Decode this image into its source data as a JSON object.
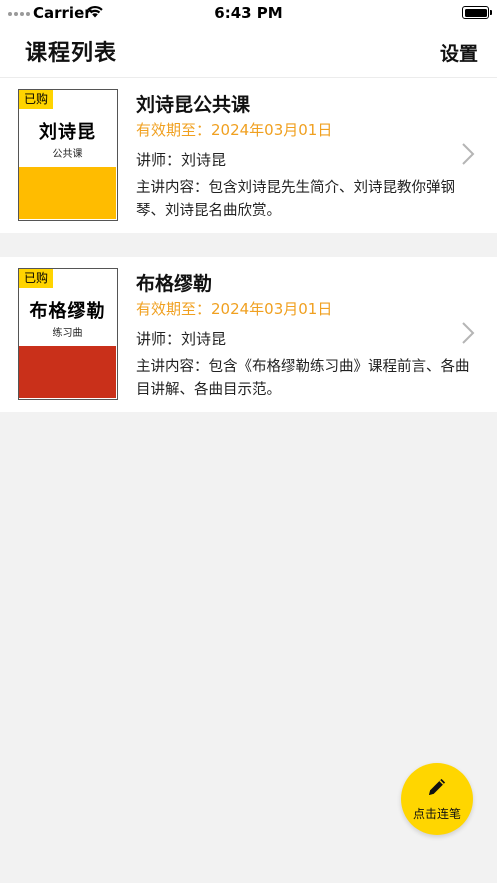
{
  "status_bar": {
    "carrier": "Carrier",
    "time": "6:43 PM",
    "icons": [
      "signal-dots-icon",
      "wifi-icon",
      "battery-icon"
    ]
  },
  "nav": {
    "title": "课程列表",
    "settings_label": "设置"
  },
  "courses": [
    {
      "cover_badge": "已购",
      "cover_name": "刘诗昆",
      "cover_sub": "公共课",
      "cover_band_color": "#ffbc00",
      "title": "刘诗昆公共课",
      "expiry": "有效期至：2024年03月01日",
      "teacher": "讲师：刘诗昆",
      "description": "主讲内容：包含刘诗昆先生简介、刘诗昆教你弹钢琴、刘诗昆名曲欣赏。"
    },
    {
      "cover_badge": "已购",
      "cover_name": "布格缪勒",
      "cover_sub": "练习曲",
      "cover_band_color": "#c9301a",
      "title": "布格缪勒",
      "expiry": "有效期至：2024年03月01日",
      "teacher": "讲师：刘诗昆",
      "description": "主讲内容：包含《布格缪勒练习曲》课程前言、各曲目讲解、各曲目示范。"
    }
  ],
  "fab": {
    "label": "点击连笔",
    "icon": "pencil-icon"
  },
  "colors": {
    "accent_yellow": "#ffd600",
    "expiry_orange": "#f0a020",
    "background": "#f2f2f2"
  }
}
